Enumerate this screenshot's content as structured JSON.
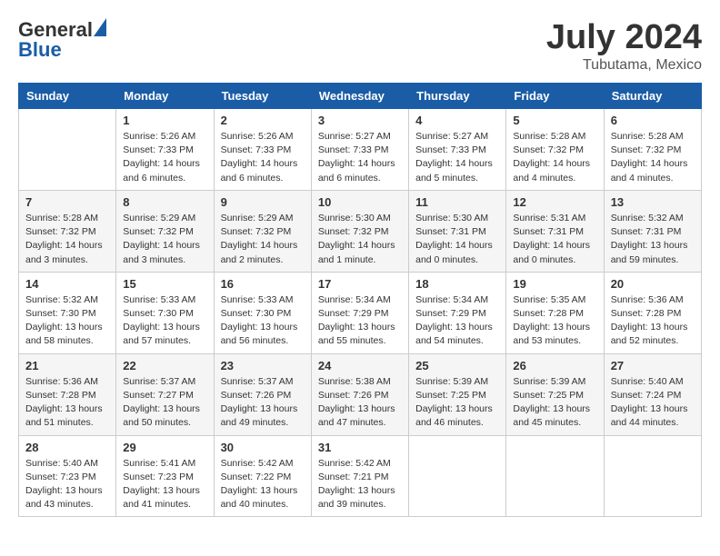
{
  "header": {
    "logo_general": "General",
    "logo_blue": "Blue",
    "title": "July 2024",
    "location": "Tubutama, Mexico"
  },
  "calendar": {
    "days_of_week": [
      "Sunday",
      "Monday",
      "Tuesday",
      "Wednesday",
      "Thursday",
      "Friday",
      "Saturday"
    ],
    "weeks": [
      [
        {
          "num": "",
          "info": ""
        },
        {
          "num": "1",
          "info": "Sunrise: 5:26 AM\nSunset: 7:33 PM\nDaylight: 14 hours\nand 6 minutes."
        },
        {
          "num": "2",
          "info": "Sunrise: 5:26 AM\nSunset: 7:33 PM\nDaylight: 14 hours\nand 6 minutes."
        },
        {
          "num": "3",
          "info": "Sunrise: 5:27 AM\nSunset: 7:33 PM\nDaylight: 14 hours\nand 6 minutes."
        },
        {
          "num": "4",
          "info": "Sunrise: 5:27 AM\nSunset: 7:33 PM\nDaylight: 14 hours\nand 5 minutes."
        },
        {
          "num": "5",
          "info": "Sunrise: 5:28 AM\nSunset: 7:32 PM\nDaylight: 14 hours\nand 4 minutes."
        },
        {
          "num": "6",
          "info": "Sunrise: 5:28 AM\nSunset: 7:32 PM\nDaylight: 14 hours\nand 4 minutes."
        }
      ],
      [
        {
          "num": "7",
          "info": "Sunrise: 5:28 AM\nSunset: 7:32 PM\nDaylight: 14 hours\nand 3 minutes."
        },
        {
          "num": "8",
          "info": "Sunrise: 5:29 AM\nSunset: 7:32 PM\nDaylight: 14 hours\nand 3 minutes."
        },
        {
          "num": "9",
          "info": "Sunrise: 5:29 AM\nSunset: 7:32 PM\nDaylight: 14 hours\nand 2 minutes."
        },
        {
          "num": "10",
          "info": "Sunrise: 5:30 AM\nSunset: 7:32 PM\nDaylight: 14 hours\nand 1 minute."
        },
        {
          "num": "11",
          "info": "Sunrise: 5:30 AM\nSunset: 7:31 PM\nDaylight: 14 hours\nand 0 minutes."
        },
        {
          "num": "12",
          "info": "Sunrise: 5:31 AM\nSunset: 7:31 PM\nDaylight: 14 hours\nand 0 minutes."
        },
        {
          "num": "13",
          "info": "Sunrise: 5:32 AM\nSunset: 7:31 PM\nDaylight: 13 hours\nand 59 minutes."
        }
      ],
      [
        {
          "num": "14",
          "info": "Sunrise: 5:32 AM\nSunset: 7:30 PM\nDaylight: 13 hours\nand 58 minutes."
        },
        {
          "num": "15",
          "info": "Sunrise: 5:33 AM\nSunset: 7:30 PM\nDaylight: 13 hours\nand 57 minutes."
        },
        {
          "num": "16",
          "info": "Sunrise: 5:33 AM\nSunset: 7:30 PM\nDaylight: 13 hours\nand 56 minutes."
        },
        {
          "num": "17",
          "info": "Sunrise: 5:34 AM\nSunset: 7:29 PM\nDaylight: 13 hours\nand 55 minutes."
        },
        {
          "num": "18",
          "info": "Sunrise: 5:34 AM\nSunset: 7:29 PM\nDaylight: 13 hours\nand 54 minutes."
        },
        {
          "num": "19",
          "info": "Sunrise: 5:35 AM\nSunset: 7:28 PM\nDaylight: 13 hours\nand 53 minutes."
        },
        {
          "num": "20",
          "info": "Sunrise: 5:36 AM\nSunset: 7:28 PM\nDaylight: 13 hours\nand 52 minutes."
        }
      ],
      [
        {
          "num": "21",
          "info": "Sunrise: 5:36 AM\nSunset: 7:28 PM\nDaylight: 13 hours\nand 51 minutes."
        },
        {
          "num": "22",
          "info": "Sunrise: 5:37 AM\nSunset: 7:27 PM\nDaylight: 13 hours\nand 50 minutes."
        },
        {
          "num": "23",
          "info": "Sunrise: 5:37 AM\nSunset: 7:26 PM\nDaylight: 13 hours\nand 49 minutes."
        },
        {
          "num": "24",
          "info": "Sunrise: 5:38 AM\nSunset: 7:26 PM\nDaylight: 13 hours\nand 47 minutes."
        },
        {
          "num": "25",
          "info": "Sunrise: 5:39 AM\nSunset: 7:25 PM\nDaylight: 13 hours\nand 46 minutes."
        },
        {
          "num": "26",
          "info": "Sunrise: 5:39 AM\nSunset: 7:25 PM\nDaylight: 13 hours\nand 45 minutes."
        },
        {
          "num": "27",
          "info": "Sunrise: 5:40 AM\nSunset: 7:24 PM\nDaylight: 13 hours\nand 44 minutes."
        }
      ],
      [
        {
          "num": "28",
          "info": "Sunrise: 5:40 AM\nSunset: 7:23 PM\nDaylight: 13 hours\nand 43 minutes."
        },
        {
          "num": "29",
          "info": "Sunrise: 5:41 AM\nSunset: 7:23 PM\nDaylight: 13 hours\nand 41 minutes."
        },
        {
          "num": "30",
          "info": "Sunrise: 5:42 AM\nSunset: 7:22 PM\nDaylight: 13 hours\nand 40 minutes."
        },
        {
          "num": "31",
          "info": "Sunrise: 5:42 AM\nSunset: 7:21 PM\nDaylight: 13 hours\nand 39 minutes."
        },
        {
          "num": "",
          "info": ""
        },
        {
          "num": "",
          "info": ""
        },
        {
          "num": "",
          "info": ""
        }
      ]
    ]
  }
}
